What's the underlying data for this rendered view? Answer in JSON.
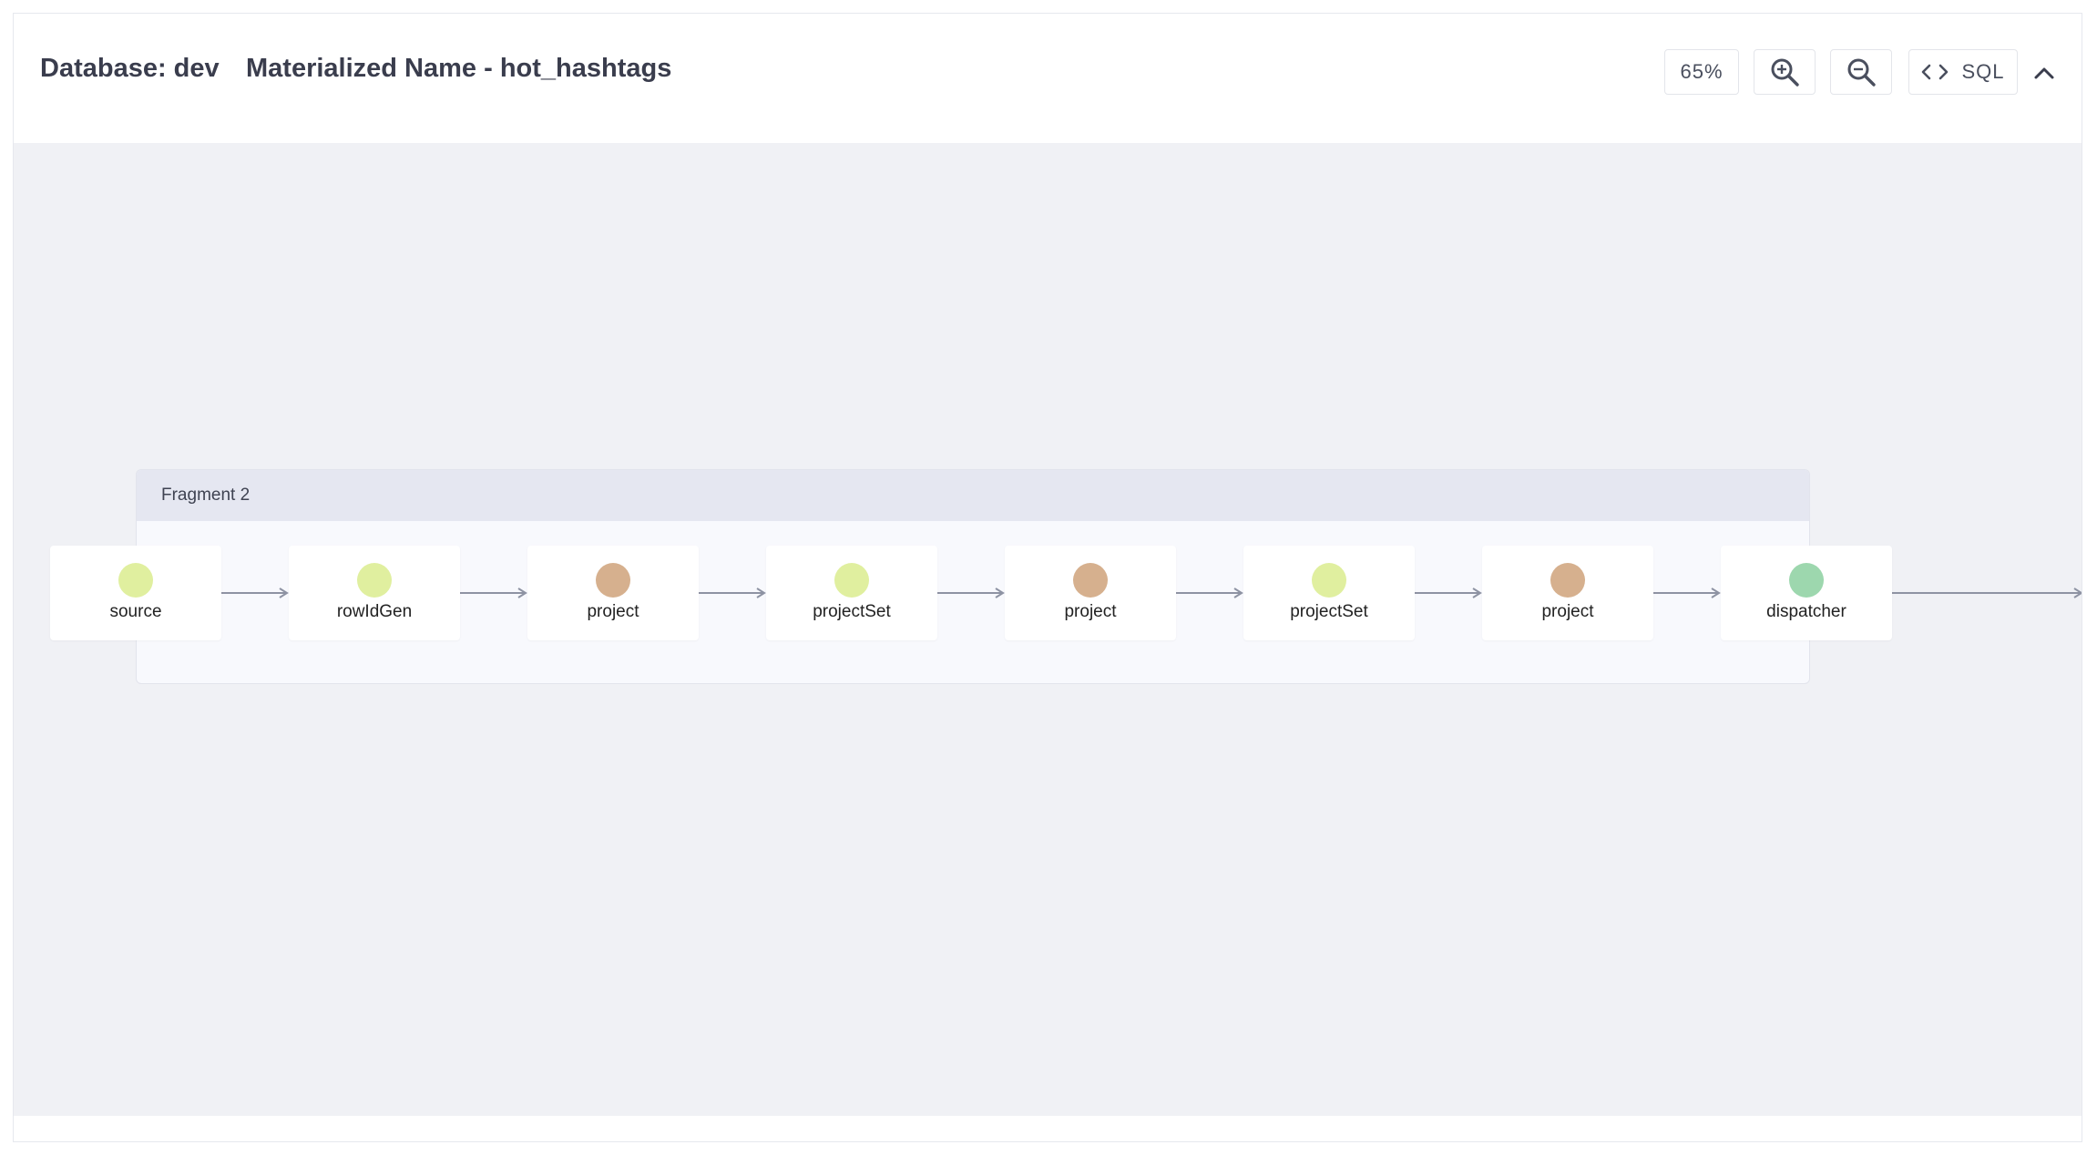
{
  "header": {
    "database_label": "Database: dev",
    "materialized_label": "Materialized Name - hot_hashtags",
    "zoom_level": "65%",
    "sql_label": "SQL"
  },
  "graph": {
    "fragment_label": "Fragment 2",
    "nodes": [
      {
        "label": "source",
        "color": "#e0ef9f"
      },
      {
        "label": "rowIdGen",
        "color": "#e0ef9f"
      },
      {
        "label": "project",
        "color": "#d6b08e"
      },
      {
        "label": "projectSet",
        "color": "#e0ef9f"
      },
      {
        "label": "project",
        "color": "#d6b08e"
      },
      {
        "label": "projectSet",
        "color": "#e0ef9f"
      },
      {
        "label": "project",
        "color": "#d6b08e"
      },
      {
        "label": "dispatcher",
        "color": "#9dd7ae"
      }
    ]
  },
  "icons": {
    "zoom_in": "zoom-in-icon",
    "zoom_out": "zoom-out-icon",
    "code": "code-icon",
    "collapse": "chevron-up-icon"
  }
}
